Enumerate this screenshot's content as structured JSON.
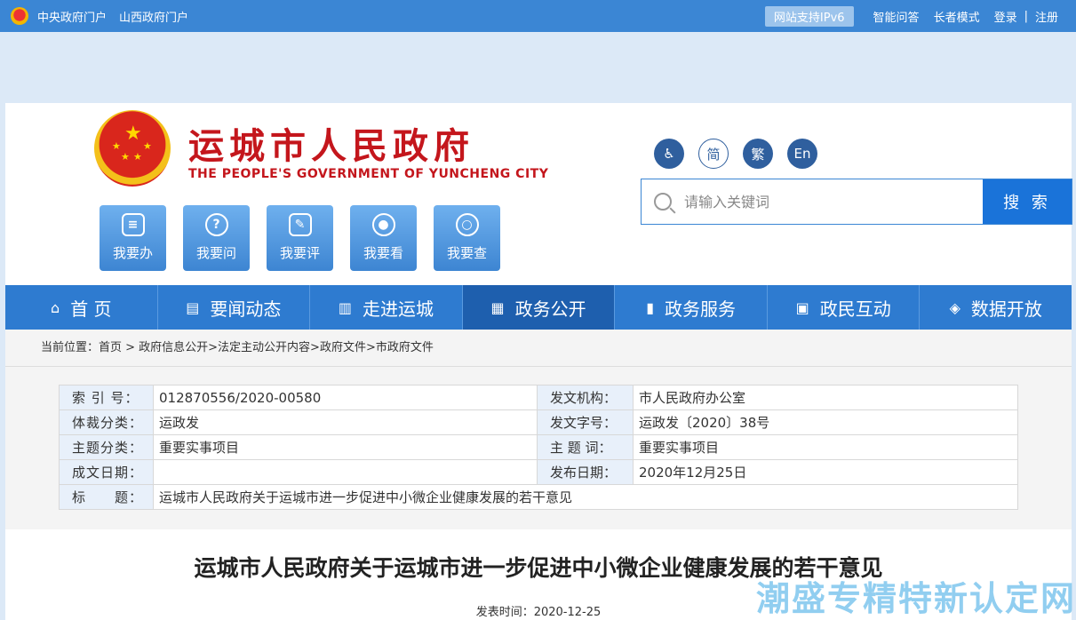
{
  "topbar": {
    "links_left": [
      "中央政府门户",
      "山西政府门户"
    ],
    "ipv6": "网站支持IPv6",
    "links_right": [
      "智能问答",
      "长者模式",
      "登录",
      "|",
      "注册"
    ]
  },
  "header": {
    "title_cn": "运城市人民政府",
    "title_en": "THE PEOPLE'S GOVERNMENT OF YUNCHENG  CITY",
    "quick_buttons": [
      "我要办",
      "我要问",
      "我要评",
      "我要看",
      "我要查"
    ],
    "langs": [
      "简",
      "繁",
      "En"
    ],
    "search_placeholder": "请输入关键词",
    "search_button": "搜 索"
  },
  "nav": {
    "items": [
      "首 页",
      "要闻动态",
      "走进运城",
      "政务公开",
      "政务服务",
      "政民互动",
      "数据开放"
    ]
  },
  "breadcrumb": "当前位置：首页 > 政府信息公开>法定主动公开内容>政府文件>市政府文件",
  "meta": {
    "rows": [
      {
        "k1": "索 引 号：",
        "v1": "012870556/2020-00580",
        "k2": "发文机构：",
        "v2": "市人民政府办公室"
      },
      {
        "k1": "体裁分类：",
        "v1": "运政发",
        "k2": "发文字号：",
        "v2": "运政发〔2020〕38号"
      },
      {
        "k1": "主题分类：",
        "v1": "重要实事项目",
        "k2": "主 题 词：",
        "v2": "重要实事项目"
      },
      {
        "k1": "成文日期：",
        "v1": "",
        "k2": "发布日期：",
        "v2": "2020年12月25日"
      }
    ],
    "title_key": "标　　题：",
    "title_val": "运城市人民政府关于运城市进一步促进中小微企业健康发展的若干意见"
  },
  "doc": {
    "title": "运城市人民政府关于运城市进一步促进中小微企业健康发展的若干意见",
    "pub_time": "发表时间：2020-12-25"
  },
  "watermark": "潮盛专精特新认定网"
}
